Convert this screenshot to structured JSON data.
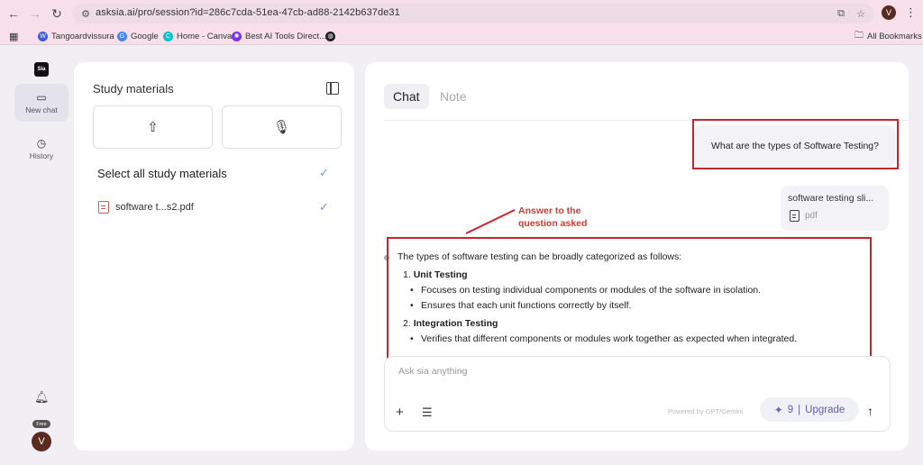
{
  "browser": {
    "url": "asksia.ai/pro/session?id=286c7cda-51ea-47cb-ad88-2142b637de31",
    "profile_initial": "V",
    "bookmarks": [
      {
        "label": "Tangoardvissura -",
        "color": "#3b5bdb"
      },
      {
        "label": "Google",
        "color": "#4285f4"
      },
      {
        "label": "Home - Canva",
        "color": "#00c4cc"
      },
      {
        "label": "Best AI Tools Direct...",
        "color": "#7b2ff7"
      },
      {
        "label": "",
        "color": "#222222"
      }
    ],
    "all_bookmarks": "All Bookmarks"
  },
  "rail": {
    "logo": "Sia",
    "new_chat": "New chat",
    "history": "History",
    "badge": "Free",
    "avatar_initial": "V"
  },
  "study": {
    "title": "Study materials",
    "select_all": "Select all study materials",
    "file_name": "software t...s2.pdf"
  },
  "chat": {
    "tabs": [
      "Chat",
      "Note"
    ],
    "user_question": "What are the types of Software Testing?",
    "file_card": {
      "name": "software testing sli...",
      "type": "pdf"
    },
    "annotation": [
      "Answer to the",
      "question asked"
    ],
    "answer": {
      "intro": "The types of software testing can be broadly categorized as follows:",
      "sections": [
        {
          "number": "1.",
          "title": "Unit Testing",
          "bullets": [
            "Focuses on testing individual components or modules of the software in isolation.",
            "Ensures that each unit functions correctly by itself."
          ]
        },
        {
          "number": "2.",
          "title": "Integration Testing",
          "bullets": [
            "Verifies that different components or modules work together as expected when integrated."
          ]
        }
      ]
    },
    "composer": {
      "placeholder": "Ask sia anything",
      "powered_by": "Powered by GPT/Gemini",
      "credits": "9",
      "separator": "|",
      "upgrade_label": "Upgrade"
    }
  },
  "colors": {
    "accent": "#5d5fb8",
    "annotation_red": "#c8242b",
    "check_blue": "#7a8fd6"
  }
}
